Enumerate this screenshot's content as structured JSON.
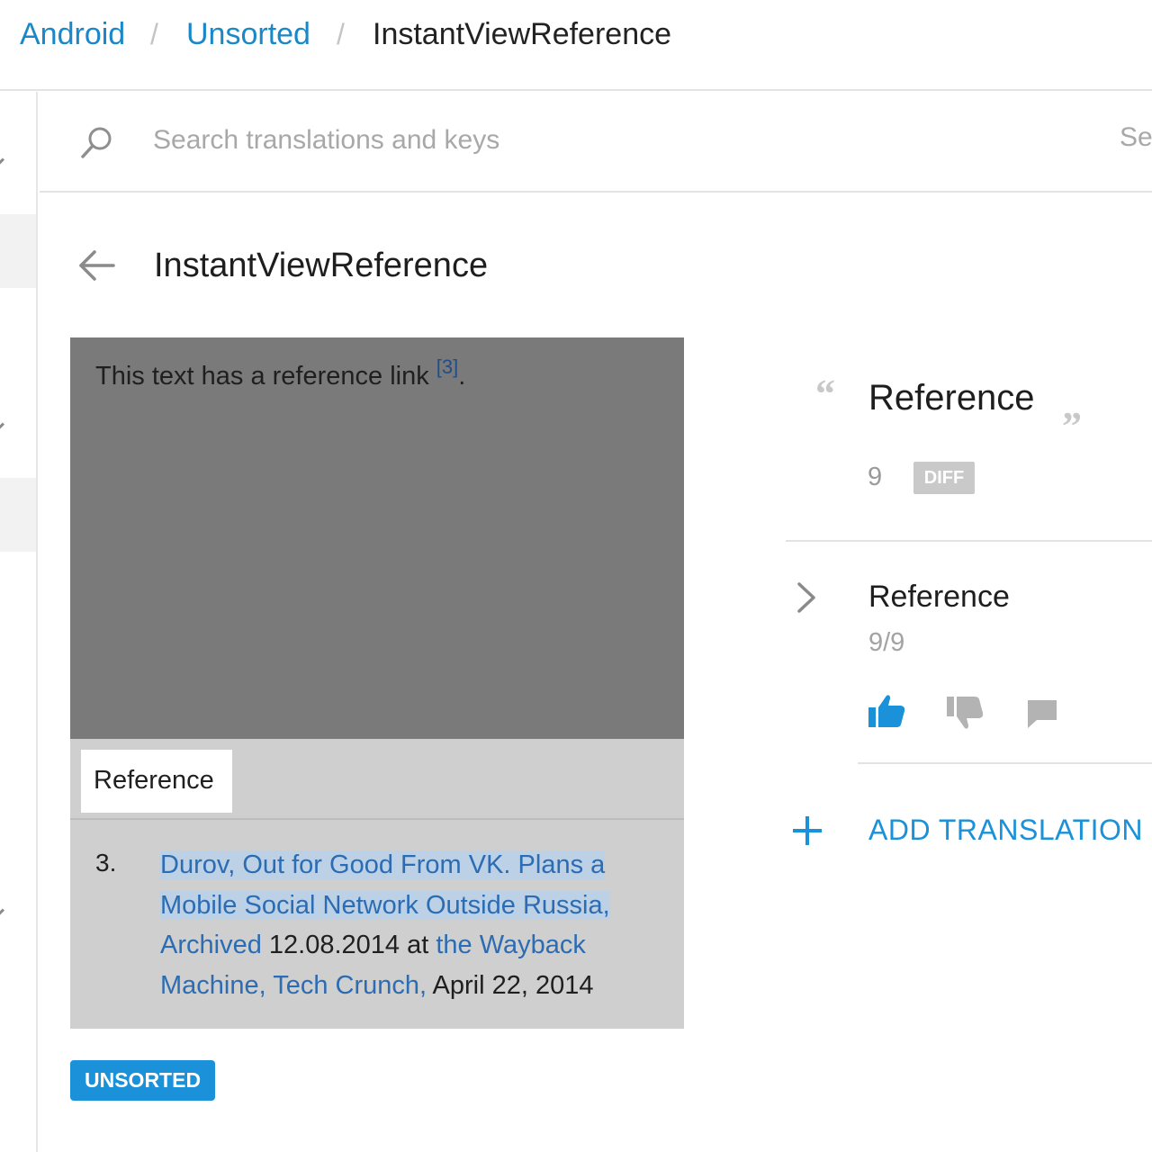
{
  "breadcrumb": {
    "items": [
      {
        "label": "Android"
      },
      {
        "label": "Unsorted"
      },
      {
        "label": "InstantViewReference"
      }
    ],
    "separator": "/"
  },
  "search": {
    "placeholder": "Search translations and keys",
    "right_text": "Se"
  },
  "key": {
    "title": "InstantViewReference"
  },
  "preview": {
    "body_text": "This text has a reference link ",
    "ref_marker": "[3]",
    "ref_suffix": ".",
    "tab_label": "Reference",
    "citation_number": "3.",
    "citation_hl": "Durov, Out for Good From VK. Plans a Mobile Social Network Outside Russia,",
    "citation_archived": "Archived",
    "citation_date": " 12.08.2014 at ",
    "citation_wayback": "the Wayback Machine,",
    "citation_techcrunch": "Tech Crunch,",
    "citation_end": " April 22, 2014"
  },
  "tag": {
    "label": "UNSORTED"
  },
  "source": {
    "quote_open": "“",
    "quote_close": "”",
    "text": "Reference",
    "char_count": "9",
    "diff_label": "DIFF"
  },
  "translation": {
    "text": "Reference",
    "count": "9/9"
  },
  "actions": {
    "add_translation": "ADD TRANSLATION"
  },
  "icons": {
    "search": "search-icon",
    "back": "arrow-left-icon",
    "chevron": "chevron-right-icon",
    "thumbs_up": "thumbs-up-icon",
    "thumbs_down": "thumbs-down-icon",
    "comment": "comment-icon",
    "plus": "plus-icon"
  },
  "colors": {
    "link": "#1a88c8",
    "accent": "#1a91d8",
    "muted": "#a8a8a8",
    "vote_active": "#1a91d8",
    "vote_inactive": "#b3b3b3"
  }
}
